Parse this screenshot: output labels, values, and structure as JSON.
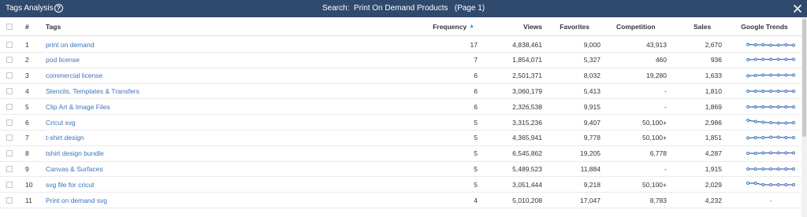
{
  "window": {
    "title": "Tags Analysis",
    "help_icon": "?",
    "search_text": "Search:  Print On Demand Products   (Page 1)"
  },
  "columns": {
    "num": "#",
    "tags": "Tags",
    "frequency": "Frequency",
    "views": "Views",
    "favorites": "Favorites",
    "competition": "Competition",
    "sales": "Sales",
    "trends": "Google Trends"
  },
  "rows": [
    {
      "num": "1",
      "tag": "print on demand",
      "frequency": "17",
      "views": "4,838,461",
      "favorites": "9,000",
      "competition": "43,913",
      "sales": "2,670",
      "trend": [
        0.45,
        0.5,
        0.5,
        0.55,
        0.55,
        0.5,
        0.55
      ]
    },
    {
      "num": "2",
      "tag": "pod license",
      "frequency": "7",
      "views": "1,854,071",
      "favorites": "5,327",
      "competition": "460",
      "sales": "936",
      "trend": [
        0.5,
        0.45,
        0.45,
        0.45,
        0.45,
        0.45,
        0.45
      ]
    },
    {
      "num": "3",
      "tag": "commercial license",
      "frequency": "6",
      "views": "2,501,371",
      "favorites": "8,032",
      "competition": "19,280",
      "sales": "1,633",
      "trend": [
        0.55,
        0.5,
        0.45,
        0.45,
        0.45,
        0.45,
        0.45
      ]
    },
    {
      "num": "4",
      "tag": "Stencils, Templates & Transfers",
      "frequency": "6",
      "views": "3,060,179",
      "favorites": "5,413",
      "competition": "-",
      "sales": "1,810",
      "trend": [
        0.5,
        0.5,
        0.5,
        0.5,
        0.5,
        0.5,
        0.5
      ]
    },
    {
      "num": "5",
      "tag": "Clip Art & Image Files",
      "frequency": "6",
      "views": "2,326,538",
      "favorites": "9,915",
      "competition": "-",
      "sales": "1,869",
      "trend": [
        0.5,
        0.5,
        0.5,
        0.5,
        0.5,
        0.5,
        0.5
      ]
    },
    {
      "num": "6",
      "tag": "Cricut svg",
      "frequency": "5",
      "views": "3,315,236",
      "favorites": "9,407",
      "competition": "50,100+",
      "sales": "2,986",
      "trend": [
        0.2,
        0.35,
        0.45,
        0.5,
        0.55,
        0.55,
        0.5
      ]
    },
    {
      "num": "7",
      "tag": "t-shirt design",
      "frequency": "5",
      "views": "4,365,941",
      "favorites": "9,778",
      "competition": "50,100+",
      "sales": "1,851",
      "trend": [
        0.55,
        0.5,
        0.5,
        0.45,
        0.45,
        0.5,
        0.5
      ]
    },
    {
      "num": "8",
      "tag": "tshirt design bundle",
      "frequency": "5",
      "views": "6,545,862",
      "favorites": "19,205",
      "competition": "6,778",
      "sales": "4,287",
      "trend": [
        0.5,
        0.5,
        0.45,
        0.45,
        0.45,
        0.45,
        0.45
      ]
    },
    {
      "num": "9",
      "tag": "Canvas & Surfaces",
      "frequency": "5",
      "views": "5,489,523",
      "favorites": "11,884",
      "competition": "-",
      "sales": "1,915",
      "trend": [
        0.5,
        0.5,
        0.5,
        0.5,
        0.5,
        0.5,
        0.5
      ]
    },
    {
      "num": "10",
      "tag": "svg file for cricut",
      "frequency": "5",
      "views": "3,051,444",
      "favorites": "9,218",
      "competition": "50,100+",
      "sales": "2,029",
      "trend": [
        0.3,
        0.3,
        0.5,
        0.5,
        0.5,
        0.5,
        0.5
      ]
    },
    {
      "num": "11",
      "tag": "Print on demand svg",
      "frequency": "4",
      "views": "5,010,208",
      "favorites": "17,047",
      "competition": "8,783",
      "sales": "4,232",
      "trend": null,
      "trend_text": "-"
    }
  ],
  "colors": {
    "titlebar": "#2f4a6d",
    "link": "#3b73b9",
    "trend_line": "#3b6fb8",
    "sort_icon": "#3b8de0"
  },
  "icons": {
    "sort": "sort-desc-icon",
    "close": "close-icon",
    "help": "help-icon"
  }
}
